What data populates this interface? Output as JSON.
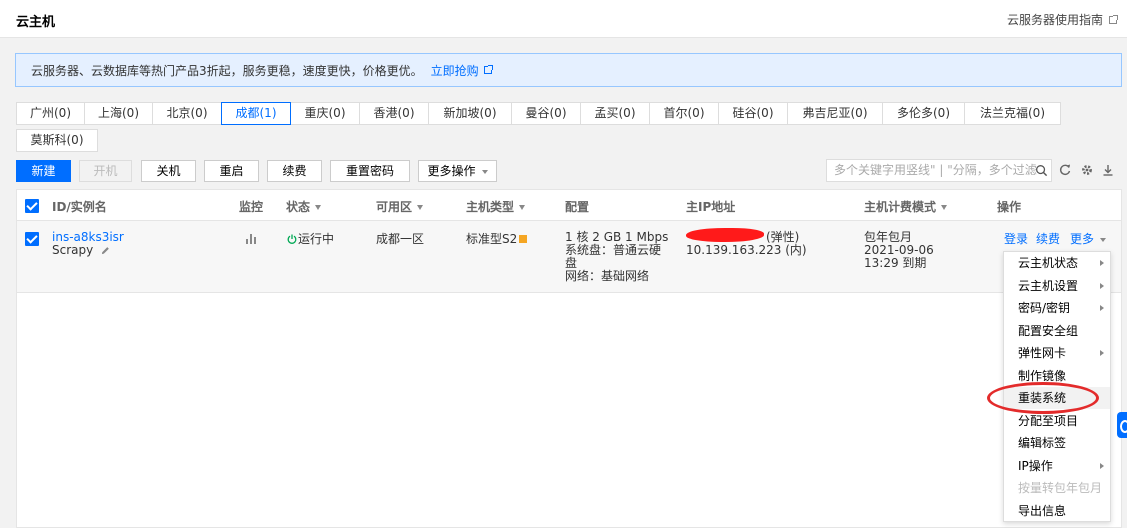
{
  "header": {
    "title": "云主机",
    "guide_link": "云服务器使用指南"
  },
  "banner": {
    "text": "云服务器、云数据库等热门产品3折起，服务更稳，速度更快，价格更优。",
    "link": "立即抢购"
  },
  "regions": [
    {
      "label": "广州(0)",
      "active": false
    },
    {
      "label": "上海(0)",
      "active": false
    },
    {
      "label": "北京(0)",
      "active": false
    },
    {
      "label": "成都(1)",
      "active": true
    },
    {
      "label": "重庆(0)",
      "active": false
    },
    {
      "label": "香港(0)",
      "active": false
    },
    {
      "label": "新加坡(0)",
      "active": false
    },
    {
      "label": "曼谷(0)",
      "active": false
    },
    {
      "label": "孟买(0)",
      "active": false
    },
    {
      "label": "首尔(0)",
      "active": false
    },
    {
      "label": "硅谷(0)",
      "active": false
    },
    {
      "label": "弗吉尼亚(0)",
      "active": false
    },
    {
      "label": "多伦多(0)",
      "active": false
    },
    {
      "label": "法兰克福(0)",
      "active": false
    },
    {
      "label": "莫斯科(0)",
      "active": false
    }
  ],
  "toolbar": {
    "new": "新建",
    "start": "开机",
    "shutdown": "关机",
    "restart": "重启",
    "renew": "续费",
    "reset_password": "重置密码",
    "more_actions": "更多操作",
    "search_placeholder": "多个关键字用竖线\" | \"分隔，多个过滤"
  },
  "table": {
    "columns": {
      "id_name": "ID/实例名",
      "monitor": "监控",
      "status": "状态",
      "zone": "可用区",
      "host_type": "主机类型",
      "config": "配置",
      "ip": "主IP地址",
      "billing": "主机计费模式",
      "ops": "操作"
    },
    "rows": [
      {
        "id": "ins-a8ks3isr",
        "name": "Scrapy",
        "status": "运行中",
        "zone": "成都一区",
        "host_type": "标准型S2",
        "config_line1": "1 核 2 GB 1 Mbps",
        "config_line2": "系统盘：普通云硬",
        "config_line3": "盘",
        "config_line4": "网络：基础网络",
        "ip_public_suffix": "(弹性)",
        "ip_private": "10.139.163.223 (内)",
        "billing_mode": "包年包月",
        "billing_date": "2021-09-06",
        "billing_expire": "13:29 到期",
        "op_login": "登录",
        "op_renew": "续费",
        "op_more": "更多"
      }
    ]
  },
  "more_menu": [
    {
      "label": "云主机状态",
      "submenu": true,
      "disabled": false
    },
    {
      "label": "云主机设置",
      "submenu": true,
      "disabled": false
    },
    {
      "label": "密码/密钥",
      "submenu": true,
      "disabled": false
    },
    {
      "label": "配置安全组",
      "submenu": false,
      "disabled": false
    },
    {
      "label": "弹性网卡",
      "submenu": true,
      "disabled": false
    },
    {
      "label": "制作镜像",
      "submenu": false,
      "disabled": false
    },
    {
      "label": "重装系统",
      "submenu": false,
      "disabled": false
    },
    {
      "label": "分配至项目",
      "submenu": false,
      "disabled": false
    },
    {
      "label": "编辑标签",
      "submenu": false,
      "disabled": false
    },
    {
      "label": "IP操作",
      "submenu": true,
      "disabled": false
    },
    {
      "label": "按量转包年包月",
      "submenu": false,
      "disabled": true
    },
    {
      "label": "导出信息",
      "submenu": false,
      "disabled": false
    }
  ],
  "colors": {
    "accent": "#006eff",
    "running": "#00a854",
    "annotation": "#e32b2b"
  }
}
